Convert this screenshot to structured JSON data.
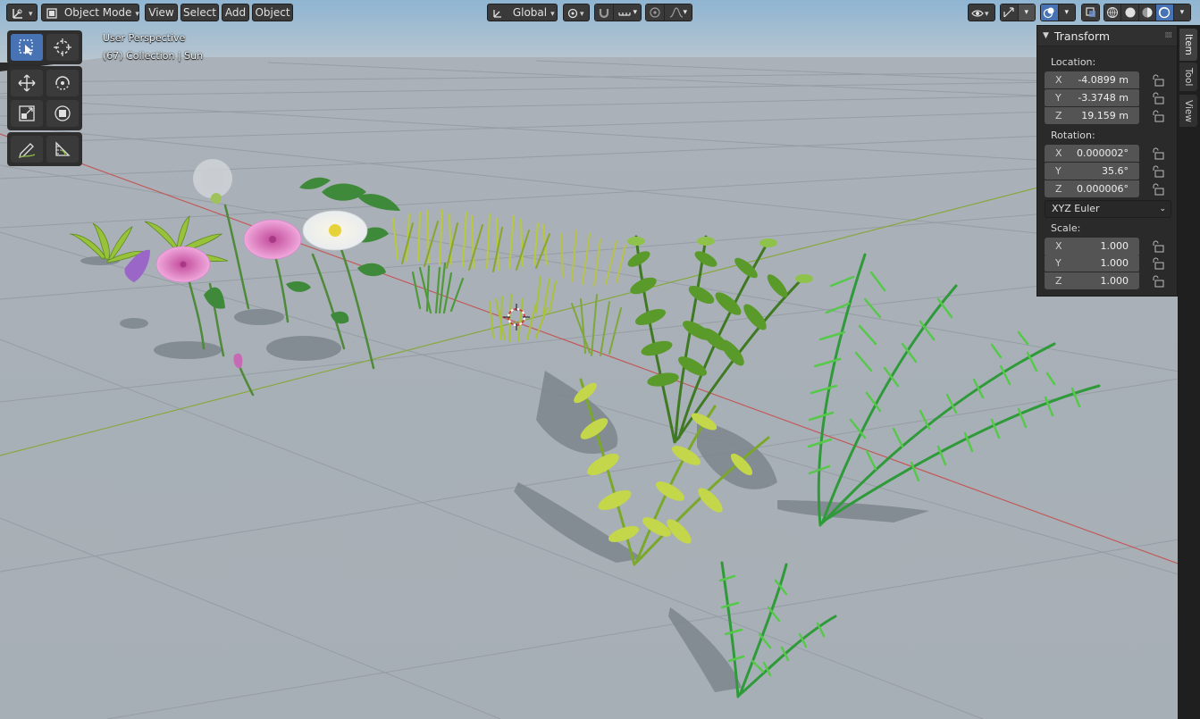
{
  "header": {
    "editor_type_icon": "viewport-editor-icon",
    "mode_label": "Object Mode",
    "menus": [
      "View",
      "Select",
      "Add",
      "Object"
    ],
    "transform_orientation": "Global",
    "pivot_icon": "pivot-point-icon",
    "snap_icon": "magnet-icon",
    "proportional_icon": "proportional-edit-icon",
    "visibility_icon": "eye-icon",
    "gizmo_icon": "gizmo-icon",
    "overlay_icon": "overlay-icon",
    "xray_icon": "xray-icon",
    "shading_modes": [
      "wireframe",
      "solid",
      "material-preview",
      "rendered"
    ],
    "active_shading": "rendered"
  },
  "viewport": {
    "perspective_label": "User Perspective",
    "collection_label": "(67) Collection | Sun",
    "colors": {
      "sky_top": "#8fb3cf",
      "horizon": "#b7c3cc",
      "ground": "#a5adb5",
      "grid": "#929aa1",
      "x_axis": "#c25a5a",
      "y_axis": "#7ea03e"
    }
  },
  "toolbar": {
    "tools": [
      "select-box",
      "cursor",
      "move",
      "rotate",
      "scale",
      "transform",
      "annotate",
      "measure"
    ],
    "active_tool": "select-box"
  },
  "npanel": {
    "title": "Transform",
    "location_label": "Location:",
    "location": [
      {
        "axis": "X",
        "value": "-4.0899 m"
      },
      {
        "axis": "Y",
        "value": "-3.3748 m"
      },
      {
        "axis": "Z",
        "value": "19.159 m"
      }
    ],
    "rotation_label": "Rotation:",
    "rotation": [
      {
        "axis": "X",
        "value": "0.000002°"
      },
      {
        "axis": "Y",
        "value": "35.6°"
      },
      {
        "axis": "Z",
        "value": "0.000006°"
      }
    ],
    "rotation_mode": "XYZ Euler",
    "scale_label": "Scale:",
    "scale": [
      {
        "axis": "X",
        "value": "1.000"
      },
      {
        "axis": "Y",
        "value": "1.000"
      },
      {
        "axis": "Z",
        "value": "1.000"
      }
    ]
  },
  "sidetabs": [
    "Item",
    "Tool",
    "View"
  ],
  "active_sidetab": "Item"
}
